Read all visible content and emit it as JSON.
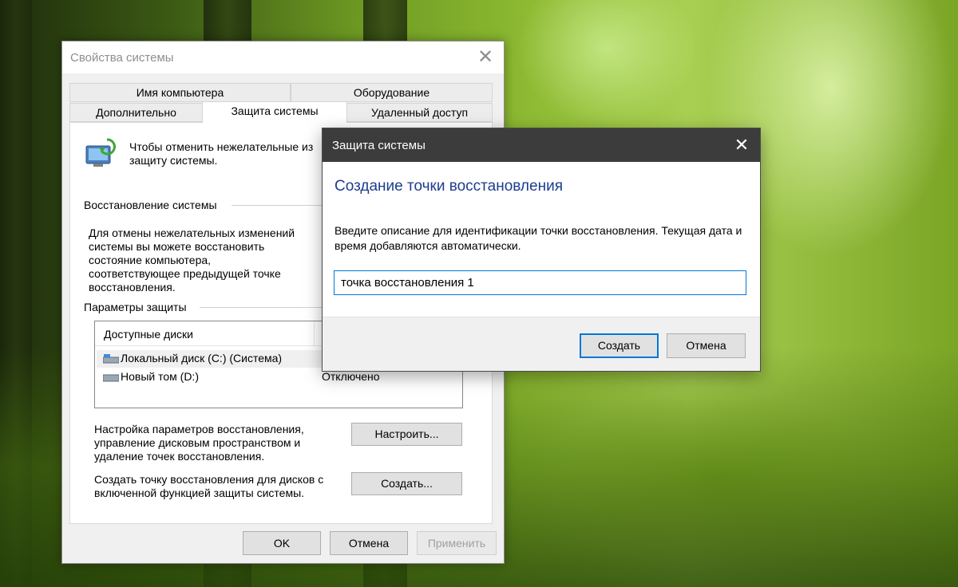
{
  "system_properties": {
    "title": "Свойства системы",
    "close_glyph": "✕",
    "tabs_row1": [
      "Имя компьютера",
      "Оборудование"
    ],
    "tabs_row2": [
      "Дополнительно",
      "Защита системы",
      "Удаленный доступ"
    ],
    "active_tab": "Защита системы",
    "intro_text_line1": "Чтобы отменить нежелательные из",
    "intro_text_line2": "защиту системы.",
    "restore_section_label": "Восстановление системы",
    "restore_desc": [
      "Для отмены нежелательных изменений",
      "системы вы можете восстановить",
      "состояние компьютера,",
      "соответствующее предыдущей точке",
      "восстановления."
    ],
    "protection_section_label": "Параметры защиты",
    "disks_column_header": "Доступные диски",
    "disks": [
      {
        "name": "Локальный диск (C:) (Система)",
        "status": "",
        "icon": "system-drive-icon"
      },
      {
        "name": "Новый том (D:)",
        "status": "Отключено",
        "icon": "drive-icon"
      }
    ],
    "configure_desc": [
      "Настройка параметров восстановления,",
      "управление дисковым пространством и",
      "удаление точек восстановления."
    ],
    "configure_button": "Настроить...",
    "create_desc": [
      "Создать точку восстановления для дисков с",
      "включенной функцией защиты системы."
    ],
    "create_button": "Создать...",
    "ok_button": "OK",
    "cancel_button": "Отмена",
    "apply_button": "Применить"
  },
  "restore_point_dialog": {
    "title": "Защита системы",
    "close_glyph": "✕",
    "heading": "Создание точки восстановления",
    "description": "Введите описание для идентификации точки восстановления. Текущая дата и время добавляются автоматически.",
    "input_value": "точка восстановления 1",
    "create_button": "Создать",
    "cancel_button": "Отмена"
  },
  "colors": {
    "accent": "#0078d7",
    "heading": "#1e3d8f",
    "dialog_titlebar": "#3c3c3c"
  }
}
